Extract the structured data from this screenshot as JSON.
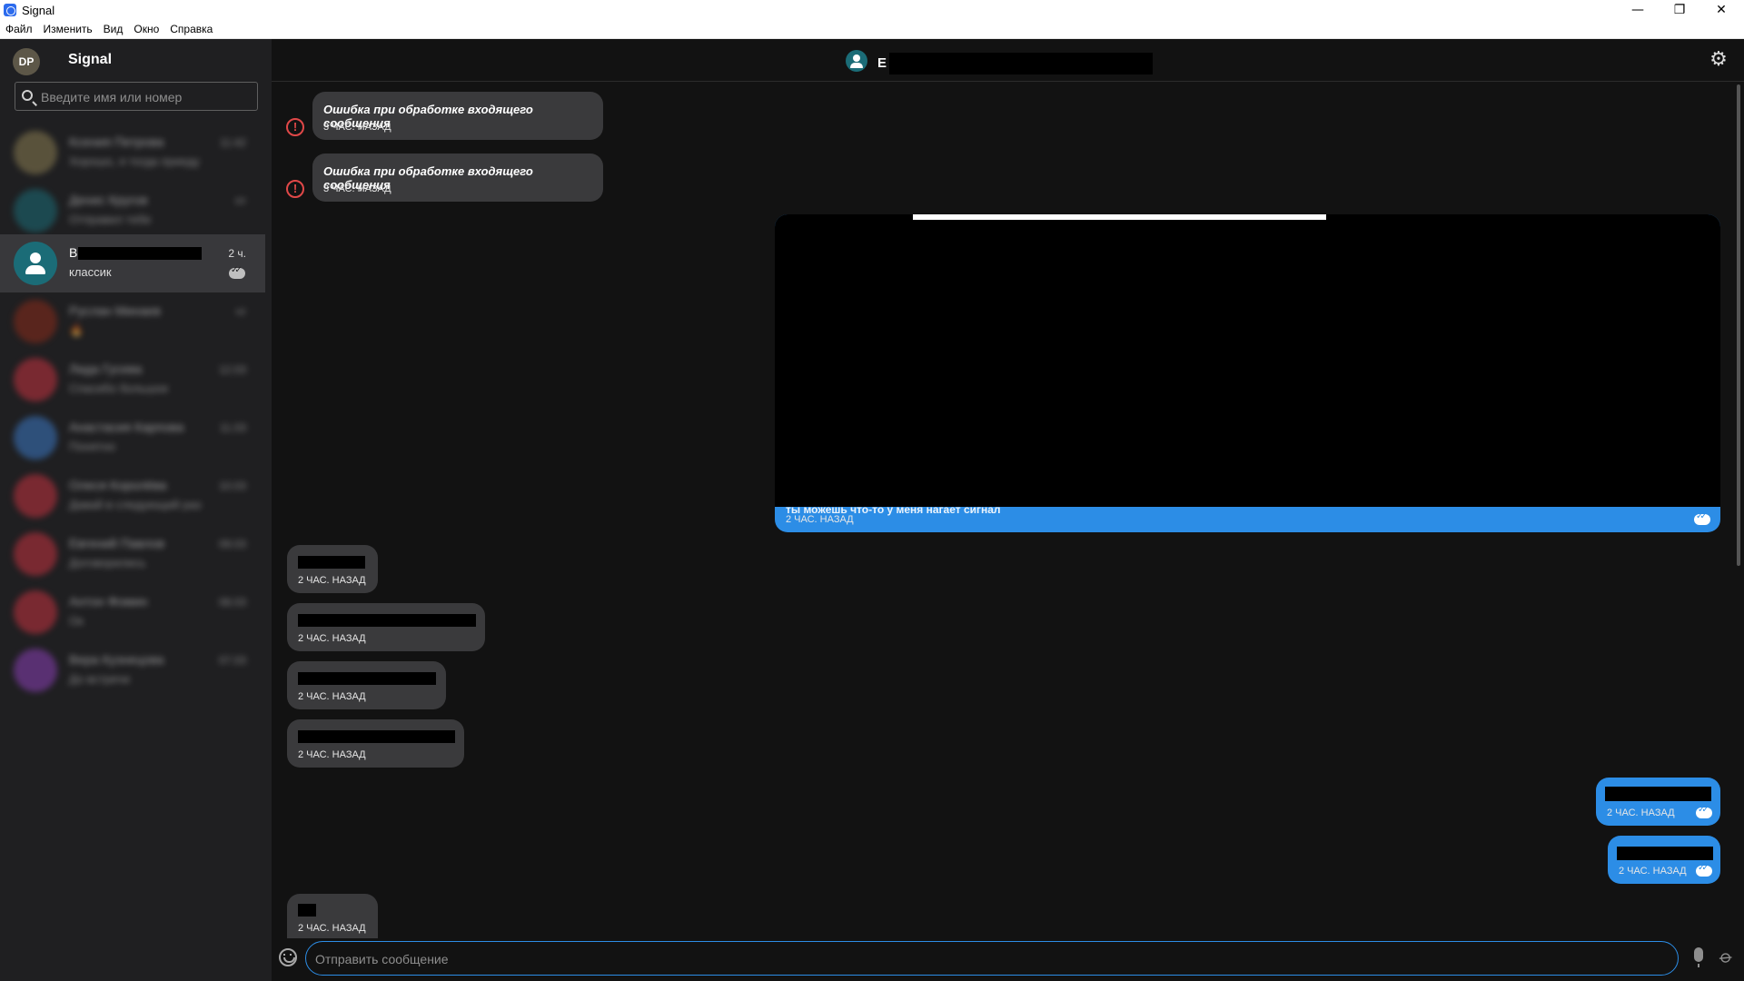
{
  "window": {
    "title": "Signal",
    "controls": [
      "—",
      "❐",
      "✕"
    ]
  },
  "menu": [
    "Файл",
    "Изменить",
    "Вид",
    "Окно",
    "Справка"
  ],
  "sidebar": {
    "profile_initials": "DP",
    "title": "Signal",
    "search_placeholder": "Введите имя или номер",
    "conversations": [
      {
        "name": "Ксения Петрова",
        "preview": "Хорошо, я тогда приеду",
        "time": "11:42",
        "color": "#8a7d52"
      },
      {
        "name": "Денис Кругов",
        "preview": "Отправил тебе",
        "time": "пт",
        "color": "#1b6c77"
      },
      {
        "name": "В",
        "preview": "классик",
        "time": "2 ч.",
        "color": "#1b6c77",
        "active": true
      },
      {
        "name": "Руслан Минаев",
        "preview": "🔥",
        "time": "чт",
        "color": "#8a2b1a"
      },
      {
        "name": "Лида Гусева",
        "preview": "Спасибо большое",
        "time": "12.03",
        "color": "#c4323f"
      },
      {
        "name": "Анастасия Карпова",
        "preview": "Понятно",
        "time": "11.03",
        "color": "#3b78c4"
      },
      {
        "name": "Олеся Королёва",
        "preview": "Давай в следующий раз",
        "time": "10.03",
        "color": "#c4323f"
      },
      {
        "name": "Евгений Павлов",
        "preview": "Договорились",
        "time": "09.03",
        "color": "#c4323f"
      },
      {
        "name": "Антон Фомин",
        "preview": "Ок",
        "time": "08.03",
        "color": "#c4323f"
      },
      {
        "name": "Вера Кузнецова",
        "preview": "До встречи",
        "time": "07.03",
        "color": "#8a3fb5"
      }
    ]
  },
  "conversation": {
    "header_name": "Е",
    "messages": {
      "error_text": "Ошибка при обработке входящего сообщения",
      "error_time": "3 ЧАС. НАЗАД",
      "image_caption": "ты можешь что-то у меня нагает сигнал",
      "time_2h": "2 ЧАС. НАЗАД"
    },
    "composer_placeholder": "Отправить сообщение"
  },
  "colors": {
    "accent": "#2c8de6",
    "sidebar_bg": "#1f1f21",
    "main_bg": "#121212",
    "incoming_bubble": "#3a3a3c",
    "error": "#e04848"
  }
}
